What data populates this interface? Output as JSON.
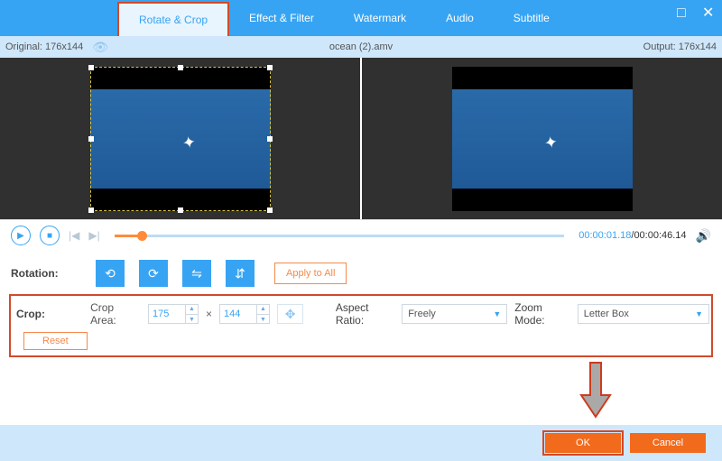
{
  "window": {
    "maximize": "□",
    "close": "✕"
  },
  "tabs": {
    "rotate_crop": "Rotate & Crop",
    "effect_filter": "Effect & Filter",
    "watermark": "Watermark",
    "audio": "Audio",
    "subtitle": "Subtitle"
  },
  "info": {
    "original_label": "Original: 176x144",
    "filename": "ocean (2).amv",
    "output_label": "Output: 176x144"
  },
  "playback": {
    "current": "00:00:01.18",
    "sep": "/",
    "duration": "00:00:46.14"
  },
  "rotation": {
    "label": "Rotation:",
    "apply_all": "Apply to All"
  },
  "crop": {
    "label": "Crop:",
    "area_label": "Crop Area:",
    "width": "175",
    "times": "×",
    "height": "144",
    "aspect_label": "Aspect Ratio:",
    "aspect_value": "Freely",
    "zoom_label": "Zoom Mode:",
    "zoom_value": "Letter Box",
    "reset": "Reset"
  },
  "buttons": {
    "ok": "OK",
    "cancel": "Cancel"
  }
}
